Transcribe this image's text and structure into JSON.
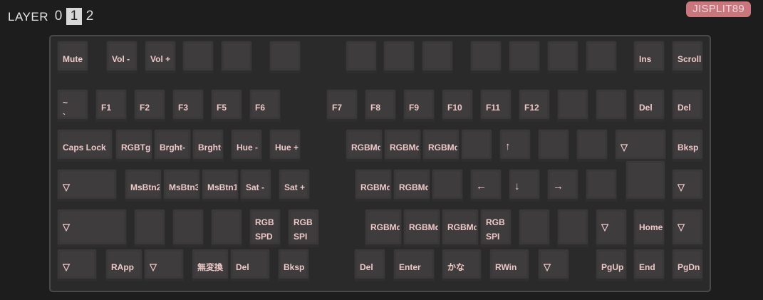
{
  "header": {
    "layer_label": "LAYER",
    "layers": [
      "0",
      "1",
      "2"
    ],
    "active_layer": "1",
    "keyboard_name": "JISPLIT89"
  },
  "keys": {
    "r1": [
      "Mute",
      "Vol -",
      "Vol +",
      "",
      "",
      "",
      "",
      "",
      "",
      "",
      "",
      "",
      "",
      "Ins",
      "Scroll"
    ],
    "r2": [
      "~\n`",
      "F1",
      "F2",
      "F3",
      "F5",
      "F6",
      "F7",
      "F8",
      "F9",
      "F10",
      "F11",
      "F12",
      "",
      "",
      "Del",
      "Del"
    ],
    "r3": [
      "Caps Lock",
      "RGBTgg",
      "Brght-",
      "Brght+",
      "Hue -",
      "Hue +",
      "RGBMdl",
      "RGBMdl",
      "RGBMdl",
      "",
      "↑",
      "",
      "",
      "▽",
      "Bksp"
    ],
    "r4": [
      "▽",
      "MsBtn2",
      "MsBtn3",
      "MsBtn1",
      "Sat -",
      "Sat +",
      "RGBMd:",
      "RGBMd:",
      "",
      "←",
      "↓",
      "→",
      "",
      "▽"
    ],
    "r5": [
      "▽",
      "",
      "",
      "",
      "RGB\nSPD",
      "RGB\nSPI",
      "RGBMdl",
      "RGBMd:",
      "RGBMdl",
      "RGB\nSPI",
      "",
      "",
      "▽",
      "Home",
      "▽"
    ],
    "r6": [
      "▽",
      "RApp",
      "▽",
      "無変換",
      "Del",
      "Bksp",
      "Del",
      "Enter",
      "かな",
      "RWin",
      "▽",
      "PgUp",
      "End",
      "PgDn"
    ]
  }
}
